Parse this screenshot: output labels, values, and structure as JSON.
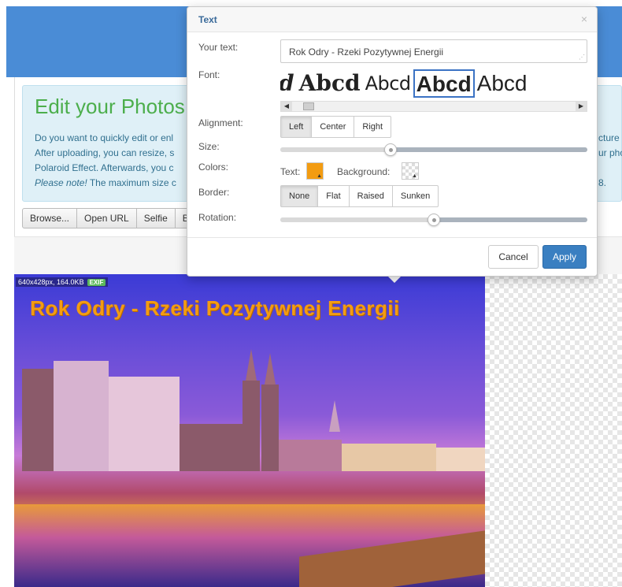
{
  "page": {
    "alert": {
      "title": "Edit your Photos",
      "line1": "Do you want to quickly edit or enl",
      "line2": "After uploading, you can resize, s",
      "line3": "Polaroid Effect. Afterwards, you c",
      "line4_em": "Please note!",
      "line4_rest": " The maximum size c",
      "right1": "cture",
      "right2": "ur pho",
      "right4": "8."
    },
    "toolbar": {
      "browse": "Browse...",
      "open_url": "Open URL",
      "selfie": "Selfie",
      "cut": "B"
    },
    "photo": {
      "info": "640x428px, 164.0KB",
      "exif": "EXIF",
      "caption": "Rok Odry - Rzeki Pozytywnej Energii"
    }
  },
  "dialog": {
    "title": "Text",
    "close_icon": "×",
    "labels": {
      "your_text": "Your text:",
      "font": "Font:",
      "alignment": "Alignment:",
      "size": "Size:",
      "colors": "Colors:",
      "border": "Border:",
      "rotation": "Rotation:"
    },
    "text_value": "Rok Odry - Rzeki Pozytywnej Energii",
    "font_samples": [
      "cd",
      "Abcd",
      "Abcd",
      "Abcd",
      "Abcd"
    ],
    "selected_font_index": 3,
    "alignment": {
      "options": [
        "Left",
        "Center",
        "Right"
      ],
      "selected": "Left"
    },
    "size_level": 0.36,
    "colors": {
      "text_label": "Text:",
      "text_color": "#f39c12",
      "background_label": "Background:",
      "background_color": "transparent"
    },
    "border": {
      "options": [
        "None",
        "Flat",
        "Raised",
        "Sunken"
      ],
      "selected": "None"
    },
    "rotation_level": 0.5,
    "buttons": {
      "cancel": "Cancel",
      "apply": "Apply"
    }
  }
}
